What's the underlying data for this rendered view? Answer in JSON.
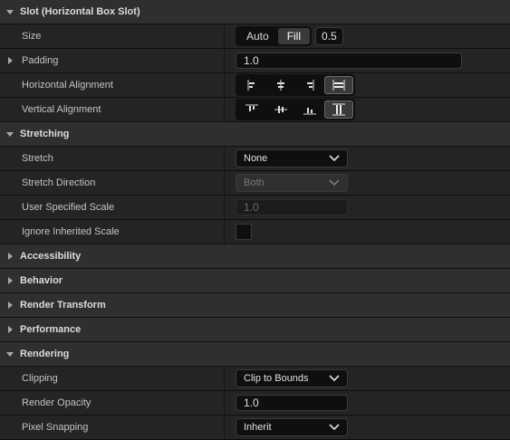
{
  "sections": {
    "slot": {
      "label": "Slot (Horizontal Box Slot)"
    },
    "stretching": {
      "label": "Stretching"
    },
    "accessibility": {
      "label": "Accessibility"
    },
    "behavior": {
      "label": "Behavior"
    },
    "render_transform": {
      "label": "Render Transform"
    },
    "performance": {
      "label": "Performance"
    },
    "rendering": {
      "label": "Rendering"
    }
  },
  "slot": {
    "size": {
      "label": "Size",
      "options": [
        "Auto",
        "Fill"
      ],
      "selected": "Fill",
      "value": "0.5"
    },
    "padding": {
      "label": "Padding",
      "value": "1.0"
    },
    "horizontal_alignment": {
      "label": "Horizontal Alignment",
      "selected_icon": "horizontal-fill-icon"
    },
    "vertical_alignment": {
      "label": "Vertical Alignment",
      "selected_icon": "vertical-fill-icon"
    }
  },
  "stretching": {
    "stretch": {
      "label": "Stretch",
      "value": "None"
    },
    "stretch_direction": {
      "label": "Stretch Direction",
      "value": "Both"
    },
    "user_specified_scale": {
      "label": "User Specified Scale",
      "value": "1.0"
    },
    "ignore_inherited_scale": {
      "label": "Ignore Inherited Scale",
      "checked": false
    }
  },
  "rendering": {
    "clipping": {
      "label": "Clipping",
      "value": "Clip to Bounds"
    },
    "render_opacity": {
      "label": "Render Opacity",
      "value": "1.0"
    },
    "pixel_snapping": {
      "label": "Pixel Snapping",
      "value": "Inherit"
    }
  },
  "colors": {
    "category_bg": "#2f2f2f",
    "row_bg": "#242424",
    "input_bg": "#0f0f0f",
    "text": "#c0c0c0"
  }
}
